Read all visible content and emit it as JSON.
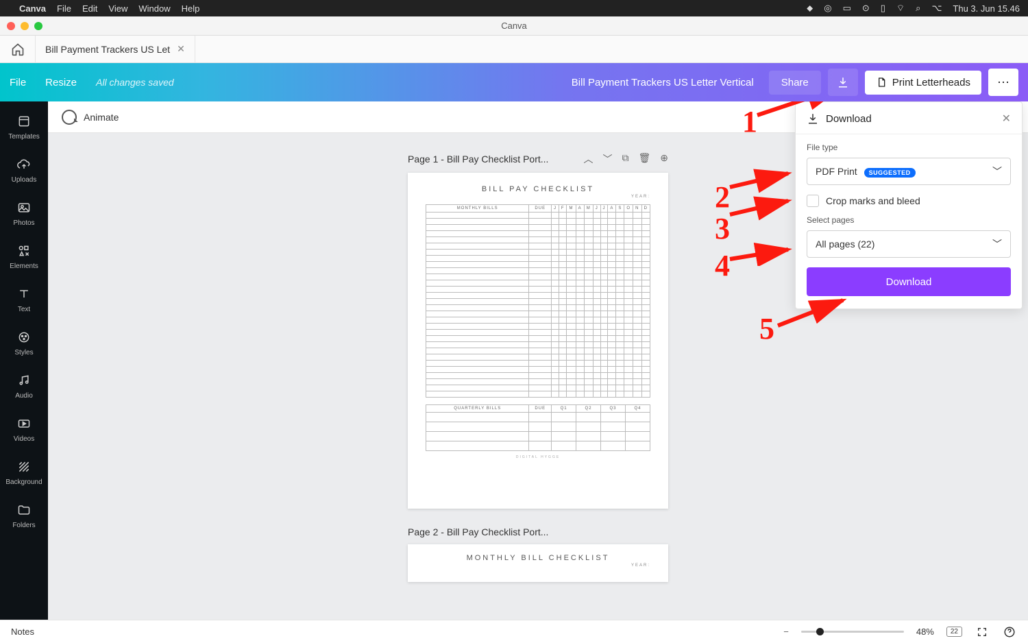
{
  "mac": {
    "app": "Canva",
    "menus": [
      "File",
      "Edit",
      "View",
      "Window",
      "Help"
    ],
    "clock": "Thu 3. Jun  15.46"
  },
  "window": {
    "title": "Canva"
  },
  "tab": {
    "label": "Bill Payment Trackers US Let"
  },
  "action": {
    "file": "File",
    "resize": "Resize",
    "saved": "All changes saved",
    "docname": "Bill Payment Trackers US Letter Vertical",
    "share": "Share",
    "print": "Print Letterheads"
  },
  "side": [
    {
      "label": "Templates"
    },
    {
      "label": "Uploads"
    },
    {
      "label": "Photos"
    },
    {
      "label": "Elements"
    },
    {
      "label": "Text"
    },
    {
      "label": "Styles"
    },
    {
      "label": "Audio"
    },
    {
      "label": "Videos"
    },
    {
      "label": "Background"
    },
    {
      "label": "Folders"
    }
  ],
  "animate_label": "Animate",
  "page1": {
    "header": "Page 1 - Bill Pay Checklist Port...",
    "title": "BILL PAY CHECKLIST",
    "year": "YEAR:",
    "monthly_header": "MONTHLY BILLS",
    "due": "DUE",
    "months": [
      "J",
      "F",
      "M",
      "A",
      "M",
      "J",
      "J",
      "A",
      "S",
      "O",
      "N",
      "D"
    ],
    "quarterly_header": "QUARTERLY BILLS",
    "quarters": [
      "Q1",
      "Q2",
      "Q3",
      "Q4"
    ],
    "footer": "DIGITAL HYGGE"
  },
  "page2": {
    "header": "Page 2 - Bill Pay Checklist Port...",
    "title": "MONTHLY BILL CHECKLIST",
    "year": "YEAR:"
  },
  "download": {
    "title": "Download",
    "file_type_label": "File type",
    "file_type_value": "PDF Print",
    "suggested": "SUGGESTED",
    "crop_label": "Crop marks and bleed",
    "select_pages_label": "Select pages",
    "select_pages_value": "All pages (22)",
    "button": "Download"
  },
  "bottom": {
    "notes": "Notes",
    "zoom": "48%",
    "pages": "22"
  },
  "annotations": [
    "1",
    "2",
    "3",
    "4",
    "5"
  ]
}
